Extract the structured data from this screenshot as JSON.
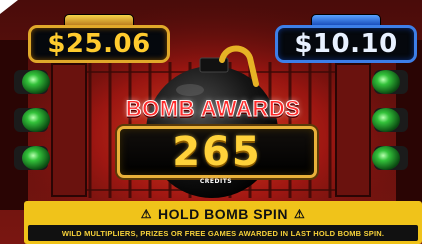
{
  "theme": {
    "gold": "#f0c31a",
    "red": "#ff2a2a",
    "blue": "#3d7fe8",
    "green": "#2f9d3a",
    "dark": "#05080d"
  },
  "meters": {
    "left": {
      "value": "$25.06"
    },
    "right": {
      "value": "$10.10"
    }
  },
  "bonus": {
    "title": "BOMB AWARDS",
    "value": "265",
    "unit": "CREDITS"
  },
  "banner": {
    "warning_icon": "warning-icon",
    "headline": "HOLD BOMB SPIN",
    "subline": "WILD MULTIPLIERS, PRIZES OR FREE GAMES AWARDED IN LAST HOLD BOMB SPIN."
  },
  "icons": [
    "bomb-icon",
    "green-light-icon",
    "warning-icon"
  ]
}
